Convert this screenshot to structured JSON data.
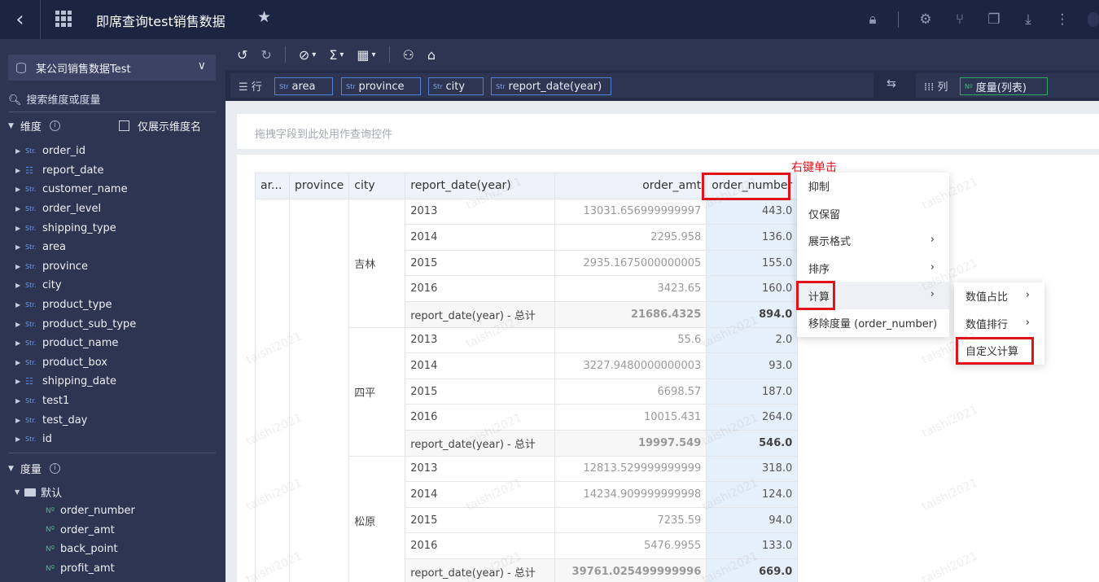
{
  "topbar": {
    "title": "即席查询test销售数据",
    "icons": [
      "back-icon",
      "grid-icon",
      "star-icon",
      "lock-icon",
      "gear-icon",
      "share-icon",
      "copy-icon",
      "download-icon",
      "more-icon"
    ]
  },
  "left": {
    "datasource": "某公司销售数据Test",
    "search_placeholder": "搜索维度或度量",
    "dim_header": "维度",
    "only_show_dim": "仅展示维度名",
    "dimensions": [
      {
        "label": "order_id",
        "tag": "Str."
      },
      {
        "label": "report_date",
        "tag": "hier"
      },
      {
        "label": "customer_name",
        "tag": "Str."
      },
      {
        "label": "order_level",
        "tag": "Str."
      },
      {
        "label": "shipping_type",
        "tag": "Str."
      },
      {
        "label": "area",
        "tag": "Str."
      },
      {
        "label": "province",
        "tag": "Str."
      },
      {
        "label": "city",
        "tag": "Str."
      },
      {
        "label": "product_type",
        "tag": "Str."
      },
      {
        "label": "product_sub_type",
        "tag": "Str."
      },
      {
        "label": "product_name",
        "tag": "Str."
      },
      {
        "label": "product_box",
        "tag": "Str."
      },
      {
        "label": "shipping_date",
        "tag": "hier"
      },
      {
        "label": "test1",
        "tag": "Str."
      },
      {
        "label": "test_day",
        "tag": "Str."
      },
      {
        "label": "id",
        "tag": "Str."
      }
    ],
    "meas_header": "度量",
    "folder": "默认",
    "measures": [
      "order_number",
      "order_amt",
      "back_point",
      "profit_amt"
    ],
    "num_tag": "Nº"
  },
  "shelf": {
    "row_label": "☰ 行",
    "col_label": "⁞⁞⁞ 列",
    "row_chips": [
      "area",
      "province",
      "city",
      "report_date(year)"
    ],
    "col_chip": "度量(列表)",
    "str_tag": "Str"
  },
  "filter_placeholder": "拖拽字段到此处用作查询控件",
  "annotation": "右键单击",
  "table": {
    "headers": [
      "ar...",
      "province",
      "city",
      "report_date(year)",
      "order_amt",
      "order_number"
    ],
    "groups": [
      {
        "city": "吉林",
        "rows": [
          [
            "2013",
            "13031.656999999997",
            "443.0"
          ],
          [
            "2014",
            "2295.958",
            "136.0"
          ],
          [
            "2015",
            "2935.1675000000005",
            "155.0"
          ],
          [
            "2016",
            "3423.65",
            "160.0"
          ],
          [
            "report_date(year) - 总计",
            "21686.4325",
            "894.0"
          ]
        ]
      },
      {
        "city": "四平",
        "rows": [
          [
            "2013",
            "55.6",
            "2.0"
          ],
          [
            "2014",
            "3227.9480000000003",
            "93.0"
          ],
          [
            "2015",
            "6698.57",
            "187.0"
          ],
          [
            "2016",
            "10015.431",
            "264.0"
          ],
          [
            "report_date(year) - 总计",
            "19997.549",
            "546.0"
          ]
        ]
      },
      {
        "city": "松原",
        "rows": [
          [
            "2013",
            "12813.529999999999",
            "318.0"
          ],
          [
            "2014",
            "14234.909999999998",
            "124.0"
          ],
          [
            "2015",
            "7235.59",
            "94.0"
          ],
          [
            "2016",
            "5476.9955",
            "133.0"
          ],
          [
            "report_date(year) - 总计",
            "39761.025499999996",
            "669.0"
          ]
        ]
      }
    ]
  },
  "context_menu": [
    {
      "label": "抑制",
      "submenu": false
    },
    {
      "label": "仅保留",
      "submenu": false
    },
    {
      "label": "展示格式",
      "submenu": true
    },
    {
      "label": "排序",
      "submenu": true
    },
    {
      "label": "计算",
      "submenu": true
    },
    {
      "label": "移除度量 (order_number)",
      "submenu": false
    }
  ],
  "sub_menu": [
    {
      "label": "数值占比",
      "submenu": true
    },
    {
      "label": "数值排行",
      "submenu": true
    },
    {
      "label": "自定义计算",
      "submenu": false
    }
  ],
  "watermark": "taishi2021",
  "colors": {
    "topbar": "#1b2441",
    "sidebar": "#2e3553",
    "highlight_red": "#e0121a",
    "measure_col": "#e6f0fb"
  }
}
